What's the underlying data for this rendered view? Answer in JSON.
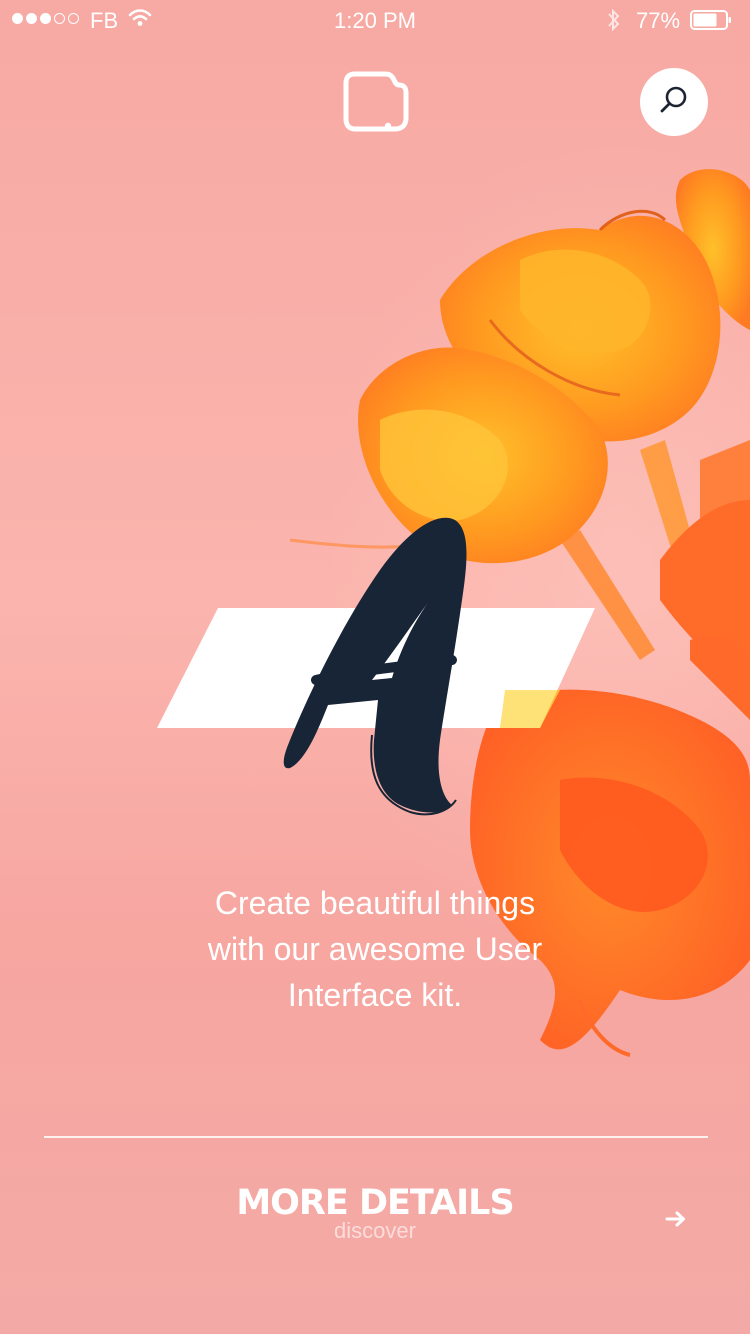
{
  "status_bar": {
    "carrier": "FB",
    "time": "1:20 PM",
    "battery_percent": "77%"
  },
  "icons": {
    "logo": "document-logo-icon",
    "search": "search-icon",
    "arrow": "arrow-right-icon"
  },
  "hero": {
    "letter": "A",
    "tagline_lines": [
      "Create beautiful things",
      "with our awesome User",
      "Interface kit."
    ]
  },
  "more": {
    "title": "MORE DETAILS",
    "subtitle": "discover"
  },
  "colors": {
    "background": "#f7a9a3",
    "letter": "#172536",
    "flower_orange": "#ff6a2a",
    "flower_yellow": "#ffb020"
  }
}
